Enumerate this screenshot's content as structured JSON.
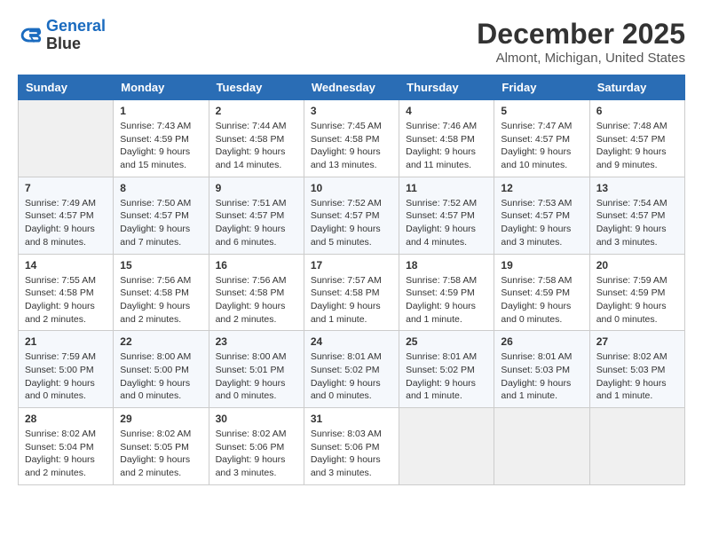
{
  "logo": {
    "line1": "General",
    "line2": "Blue"
  },
  "title": "December 2025",
  "location": "Almont, Michigan, United States",
  "weekdays": [
    "Sunday",
    "Monday",
    "Tuesday",
    "Wednesday",
    "Thursday",
    "Friday",
    "Saturday"
  ],
  "weeks": [
    [
      {
        "num": "",
        "info": ""
      },
      {
        "num": "1",
        "info": "Sunrise: 7:43 AM\nSunset: 4:59 PM\nDaylight: 9 hours\nand 15 minutes."
      },
      {
        "num": "2",
        "info": "Sunrise: 7:44 AM\nSunset: 4:58 PM\nDaylight: 9 hours\nand 14 minutes."
      },
      {
        "num": "3",
        "info": "Sunrise: 7:45 AM\nSunset: 4:58 PM\nDaylight: 9 hours\nand 13 minutes."
      },
      {
        "num": "4",
        "info": "Sunrise: 7:46 AM\nSunset: 4:58 PM\nDaylight: 9 hours\nand 11 minutes."
      },
      {
        "num": "5",
        "info": "Sunrise: 7:47 AM\nSunset: 4:57 PM\nDaylight: 9 hours\nand 10 minutes."
      },
      {
        "num": "6",
        "info": "Sunrise: 7:48 AM\nSunset: 4:57 PM\nDaylight: 9 hours\nand 9 minutes."
      }
    ],
    [
      {
        "num": "7",
        "info": "Sunrise: 7:49 AM\nSunset: 4:57 PM\nDaylight: 9 hours\nand 8 minutes."
      },
      {
        "num": "8",
        "info": "Sunrise: 7:50 AM\nSunset: 4:57 PM\nDaylight: 9 hours\nand 7 minutes."
      },
      {
        "num": "9",
        "info": "Sunrise: 7:51 AM\nSunset: 4:57 PM\nDaylight: 9 hours\nand 6 minutes."
      },
      {
        "num": "10",
        "info": "Sunrise: 7:52 AM\nSunset: 4:57 PM\nDaylight: 9 hours\nand 5 minutes."
      },
      {
        "num": "11",
        "info": "Sunrise: 7:52 AM\nSunset: 4:57 PM\nDaylight: 9 hours\nand 4 minutes."
      },
      {
        "num": "12",
        "info": "Sunrise: 7:53 AM\nSunset: 4:57 PM\nDaylight: 9 hours\nand 3 minutes."
      },
      {
        "num": "13",
        "info": "Sunrise: 7:54 AM\nSunset: 4:57 PM\nDaylight: 9 hours\nand 3 minutes."
      }
    ],
    [
      {
        "num": "14",
        "info": "Sunrise: 7:55 AM\nSunset: 4:58 PM\nDaylight: 9 hours\nand 2 minutes."
      },
      {
        "num": "15",
        "info": "Sunrise: 7:56 AM\nSunset: 4:58 PM\nDaylight: 9 hours\nand 2 minutes."
      },
      {
        "num": "16",
        "info": "Sunrise: 7:56 AM\nSunset: 4:58 PM\nDaylight: 9 hours\nand 2 minutes."
      },
      {
        "num": "17",
        "info": "Sunrise: 7:57 AM\nSunset: 4:58 PM\nDaylight: 9 hours\nand 1 minute."
      },
      {
        "num": "18",
        "info": "Sunrise: 7:58 AM\nSunset: 4:59 PM\nDaylight: 9 hours\nand 1 minute."
      },
      {
        "num": "19",
        "info": "Sunrise: 7:58 AM\nSunset: 4:59 PM\nDaylight: 9 hours\nand 0 minutes."
      },
      {
        "num": "20",
        "info": "Sunrise: 7:59 AM\nSunset: 4:59 PM\nDaylight: 9 hours\nand 0 minutes."
      }
    ],
    [
      {
        "num": "21",
        "info": "Sunrise: 7:59 AM\nSunset: 5:00 PM\nDaylight: 9 hours\nand 0 minutes."
      },
      {
        "num": "22",
        "info": "Sunrise: 8:00 AM\nSunset: 5:00 PM\nDaylight: 9 hours\nand 0 minutes."
      },
      {
        "num": "23",
        "info": "Sunrise: 8:00 AM\nSunset: 5:01 PM\nDaylight: 9 hours\nand 0 minutes."
      },
      {
        "num": "24",
        "info": "Sunrise: 8:01 AM\nSunset: 5:02 PM\nDaylight: 9 hours\nand 0 minutes."
      },
      {
        "num": "25",
        "info": "Sunrise: 8:01 AM\nSunset: 5:02 PM\nDaylight: 9 hours\nand 1 minute."
      },
      {
        "num": "26",
        "info": "Sunrise: 8:01 AM\nSunset: 5:03 PM\nDaylight: 9 hours\nand 1 minute."
      },
      {
        "num": "27",
        "info": "Sunrise: 8:02 AM\nSunset: 5:03 PM\nDaylight: 9 hours\nand 1 minute."
      }
    ],
    [
      {
        "num": "28",
        "info": "Sunrise: 8:02 AM\nSunset: 5:04 PM\nDaylight: 9 hours\nand 2 minutes."
      },
      {
        "num": "29",
        "info": "Sunrise: 8:02 AM\nSunset: 5:05 PM\nDaylight: 9 hours\nand 2 minutes."
      },
      {
        "num": "30",
        "info": "Sunrise: 8:02 AM\nSunset: 5:06 PM\nDaylight: 9 hours\nand 3 minutes."
      },
      {
        "num": "31",
        "info": "Sunrise: 8:03 AM\nSunset: 5:06 PM\nDaylight: 9 hours\nand 3 minutes."
      },
      {
        "num": "",
        "info": ""
      },
      {
        "num": "",
        "info": ""
      },
      {
        "num": "",
        "info": ""
      }
    ]
  ]
}
